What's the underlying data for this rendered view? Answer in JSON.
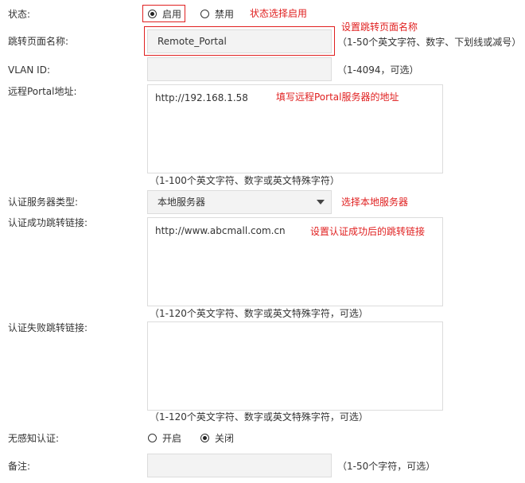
{
  "status": {
    "label": "状态:",
    "options": [
      {
        "label": "启用",
        "checked": true
      },
      {
        "label": "禁用",
        "checked": false
      }
    ],
    "annotation": "状态选择启用"
  },
  "page_name": {
    "label": "跳转页面名称:",
    "value": "Remote_Portal",
    "annotation": "设置跳转页面名称",
    "hint": "（1-50个英文字符、数字、下划线或减号）"
  },
  "vlan": {
    "label": "VLAN ID:",
    "value": "",
    "hint": "（1-4094，可选）"
  },
  "remote_portal": {
    "label": "远程Portal地址:",
    "value": "http://192.168.1.58",
    "annotation": "填写远程Portal服务器的地址",
    "hint": "（1-100个英文字符、数字或英文特殊字符）"
  },
  "auth_server_type": {
    "label": "认证服务器类型:",
    "selected": "本地服务器",
    "annotation": "选择本地服务器"
  },
  "success_link": {
    "label": "认证成功跳转链接:",
    "value": "http://www.abcmall.com.cn",
    "annotation": "设置认证成功后的跳转链接",
    "hint": "（1-120个英文字符、数字或英文特殊字符，可选）"
  },
  "fail_link": {
    "label": "认证失败跳转链接:",
    "value": "",
    "hint": "（1-120个英文字符、数字或英文特殊字符，可选）"
  },
  "seamless_auth": {
    "label": "无感知认证:",
    "options": [
      {
        "label": "开启",
        "checked": false
      },
      {
        "label": "关闭",
        "checked": true
      }
    ]
  },
  "remark": {
    "label": "备注:",
    "value": "",
    "hint": "（1-50个字符，可选）"
  },
  "colors": {
    "annotation": "#e02020",
    "field_bg": "#f3f3f3",
    "field_border": "#dcdcdc"
  }
}
